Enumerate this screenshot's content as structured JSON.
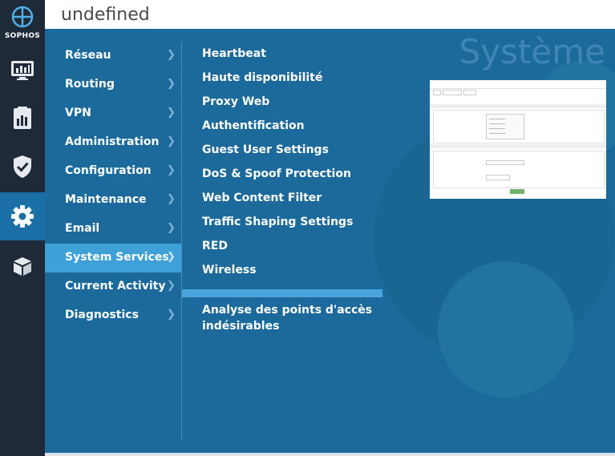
{
  "app": {
    "brand": "SOPHOS"
  },
  "header": {
    "title": "undefined"
  },
  "watermark": "Système",
  "rail": [
    {
      "name": "monitor-icon"
    },
    {
      "name": "report-icon"
    },
    {
      "name": "shield-check-icon"
    },
    {
      "name": "gear-icon",
      "active": true
    },
    {
      "name": "box-icon"
    }
  ],
  "menu": {
    "categories": [
      {
        "label": "Réseau"
      },
      {
        "label": "Routing"
      },
      {
        "label": "VPN"
      },
      {
        "label": "Administration"
      },
      {
        "label": "Configuration"
      },
      {
        "label": "Maintenance"
      },
      {
        "label": "Email"
      },
      {
        "label": "System Services",
        "active": true
      },
      {
        "label": "Current Activity"
      },
      {
        "label": "Diagnostics"
      }
    ],
    "subitems": [
      {
        "label": "Heartbeat"
      },
      {
        "label": "Haute disponibilité"
      },
      {
        "label": "Proxy Web"
      },
      {
        "label": "Authentification"
      },
      {
        "label": "Guest User Settings"
      },
      {
        "label": "DoS & Spoof Protection"
      },
      {
        "label": "Web Content Filter"
      },
      {
        "label": "Traffic Shaping Settings"
      },
      {
        "label": "RED"
      },
      {
        "label": "Wireless"
      },
      {
        "label": "Analyse des points d'accès indésirables"
      }
    ]
  },
  "colors": {
    "rail": "#1e2a38",
    "active": "#1a6fa6",
    "main": "#1c6a9b",
    "menu_active": "#3fa0d8"
  }
}
